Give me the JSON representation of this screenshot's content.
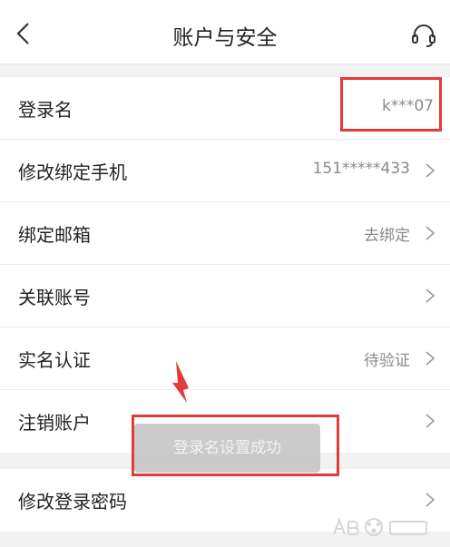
{
  "header": {
    "title": "账户与安全",
    "back_icon": "chevron-left-icon",
    "support_icon": "headset-icon"
  },
  "groups": [
    {
      "rows": [
        {
          "label": "登录名",
          "value": "k***07",
          "chevron": false
        },
        {
          "label": "修改绑定手机",
          "value": "151*****433",
          "chevron": true
        },
        {
          "label": "绑定邮箱",
          "value": "去绑定",
          "chevron": true
        },
        {
          "label": "关联账号",
          "value": "",
          "chevron": true
        },
        {
          "label": "实名认证",
          "value": "待验证",
          "chevron": true
        },
        {
          "label": "注销账户",
          "value": "",
          "chevron": true
        }
      ]
    },
    {
      "rows": [
        {
          "label": "修改登录密码",
          "value": "",
          "chevron": true
        }
      ]
    }
  ],
  "toast": {
    "text": "登录名设置成功"
  },
  "annotation_color": "#e33a3a"
}
